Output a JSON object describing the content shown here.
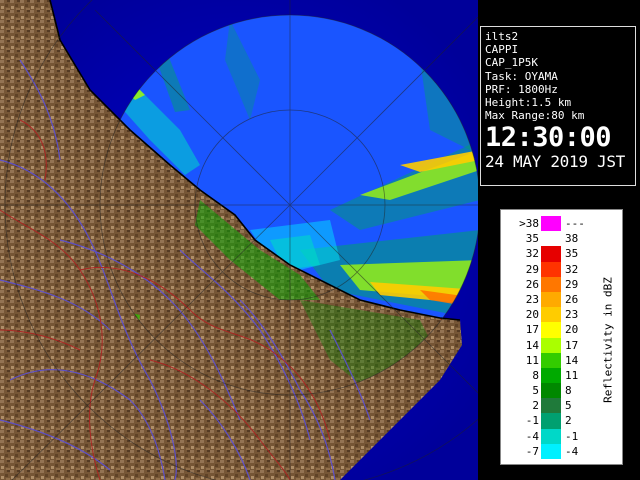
{
  "info": {
    "station_code": "ilts2",
    "product": "CAPPI",
    "product_code": "CAP_1P5K",
    "task": "Task: OYAMA",
    "prf": "PRF: 1800Hz",
    "height": "Height:1.5 km",
    "max_range": "Max Range:80 km",
    "time": "12:30:00",
    "date": "24 MAY 2019 JST"
  },
  "legend": {
    "unit": "Reflectivity in dBZ",
    "rows": [
      {
        "lo": ">38",
        "hi": "---",
        "color": "#ff00ff"
      },
      {
        "lo": "35",
        "hi": "38",
        "color": "#ffffff"
      },
      {
        "lo": "32",
        "hi": "35",
        "color": "#e60000"
      },
      {
        "lo": "29",
        "hi": "32",
        "color": "#ff3300"
      },
      {
        "lo": "26",
        "hi": "29",
        "color": "#ff7700"
      },
      {
        "lo": "23",
        "hi": "26",
        "color": "#ffaa00"
      },
      {
        "lo": "20",
        "hi": "23",
        "color": "#ffcc00"
      },
      {
        "lo": "17",
        "hi": "20",
        "color": "#ffff00"
      },
      {
        "lo": "14",
        "hi": "17",
        "color": "#aaff00"
      },
      {
        "lo": "11",
        "hi": "14",
        "color": "#33cc00"
      },
      {
        "lo": "8",
        "hi": "11",
        "color": "#00aa00"
      },
      {
        "lo": "5",
        "hi": "8",
        "color": "#008800"
      },
      {
        "lo": "2",
        "hi": "5",
        "color": "#1f7a3a"
      },
      {
        "lo": "-1",
        "hi": "2",
        "color": "#00a070"
      },
      {
        "lo": "-4",
        "hi": "-1",
        "color": "#00d8c8"
      },
      {
        "lo": "-7",
        "hi": "-4",
        "color": "#00f0ff"
      }
    ]
  },
  "colors": {
    "sea": "#0000aa",
    "radar_coverage": "#1a55ff",
    "terrain": "#7a5a3a",
    "rivers": "#5a4fd8",
    "boundaries": "#b02020"
  }
}
